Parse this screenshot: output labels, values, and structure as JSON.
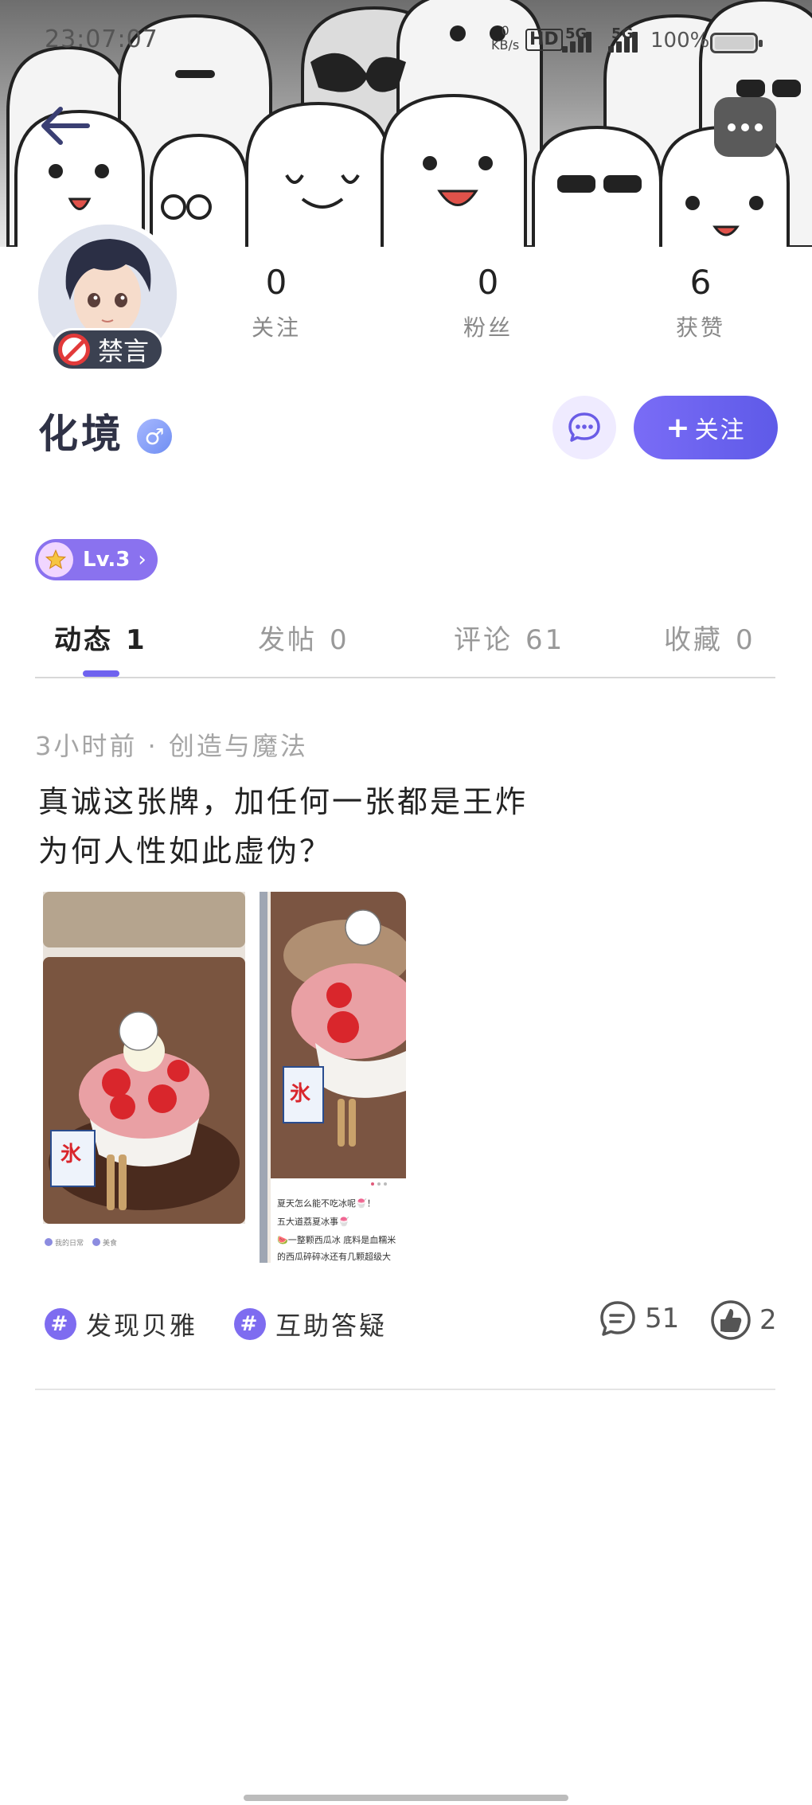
{
  "status_bar": {
    "time": "23:07:07",
    "net_speed": "0",
    "net_unit": "KB/s",
    "hd": "HD",
    "signal_1": "5G",
    "signal_2": "5G",
    "battery": "100%"
  },
  "profile": {
    "name": "化境",
    "gender_symbol": "♂",
    "mute_badge": "禁言",
    "level": "Lv.3",
    "level_arrow": "›",
    "stats": [
      {
        "value": "0",
        "label": "关注"
      },
      {
        "value": "0",
        "label": "粉丝"
      },
      {
        "value": "6",
        "label": "获赞"
      }
    ],
    "follow_plus": "+",
    "follow_label": "关注"
  },
  "tabs": [
    {
      "label": "动态",
      "count": "1"
    },
    {
      "label": "发帖",
      "count": "0"
    },
    {
      "label": "评论",
      "count": "61"
    },
    {
      "label": "收藏",
      "count": "0"
    }
  ],
  "post": {
    "meta": "3小时前 · 创造与魔法",
    "line1": "真诚这张牌，加任何一张都是王炸",
    "line2": "为何人性如此虚伪？",
    "image_sign": "氷",
    "image_caption_1": "夏天怎么能不吃冰呢🍧！",
    "image_caption_2": "五大道荔夏冰事🍧",
    "image_caption_3": "🍉一整颗西瓜冰 底料是血糯米",
    "image_caption_4": "的西瓜碎碎冰还有几颗超级大",
    "image_tag_1": "我的日常",
    "image_tag_2": "美食",
    "tags": [
      "发现贝雅",
      "互助答疑"
    ],
    "tag_symbol": "#",
    "comments": "51",
    "likes": "2"
  },
  "colors": {
    "accent": "#6f62ef",
    "follow_gradient": [
      "#7a6cf6",
      "#5e5ae8"
    ],
    "mute_red": "#e23a3a",
    "badge_dark": "#3b4151"
  }
}
